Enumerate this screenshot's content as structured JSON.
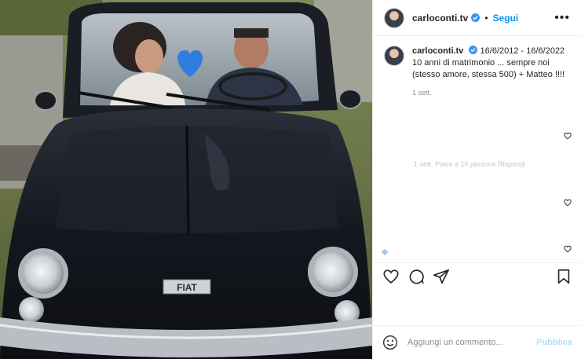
{
  "post": {
    "author": "carloconti.tv",
    "follow_label": "Segui",
    "separator": "•",
    "more_icon": "more-horizontal-icon",
    "verified_color": "#3897f0",
    "brand_text": "FIAT"
  },
  "caption": {
    "author": "carloconti.tv",
    "text": "16/6/2012 - 16/6/2022 10 anni di matrimonio ... sempre noi (stesso amore, stessa 500) + Matteo !!!!",
    "time": "1 sett."
  },
  "faded_reply": "1 sett.   Piace a 10 persone   Rispondi",
  "actions": {
    "like_icon": "heart-icon",
    "comment_icon": "comment-icon",
    "share_icon": "share-icon",
    "save_icon": "bookmark-icon"
  },
  "comment": {
    "placeholder": "Aggiungi un commento...",
    "publish_label": "Pubblica",
    "emoji_icon": "emoji-icon"
  },
  "colors": {
    "accent": "#0095f6",
    "publish_disabled": "#b2dffc",
    "car_body": "#15181f"
  }
}
